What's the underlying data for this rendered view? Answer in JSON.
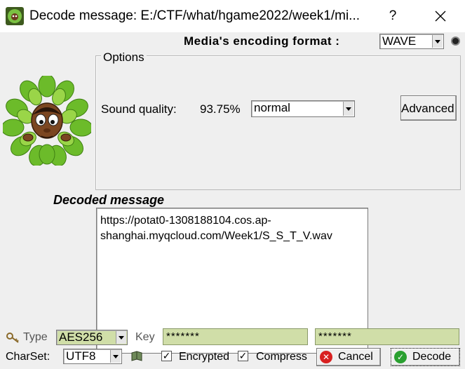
{
  "window": {
    "title": "Decode message: E:/CTF/what/hgame2022/week1/mi...",
    "help": "?"
  },
  "media": {
    "label": "Media's encoding format :",
    "format": "WAVE"
  },
  "options": {
    "legend": "Options",
    "sound_quality_label": "Sound quality:",
    "sound_quality_value": "93.75%",
    "quality_mode": "normal",
    "advanced_label": "Advanced"
  },
  "decoded": {
    "label": "Decoded message",
    "message": "https://potat0-1308188104.cos.ap-\nshanghai.myqcloud.com/Week1/S_S_T_V.wav"
  },
  "crypto": {
    "type_label": "Type",
    "type_value": "AES256",
    "key_label": "Key",
    "key1": "*******",
    "key2": "*******"
  },
  "bottom": {
    "charset_label": "CharSet:",
    "charset_value": "UTF8",
    "encrypted_label": "Encrypted",
    "compressed_label": "Compressed",
    "cancel_label": "Cancel",
    "decode_label": "Decode"
  },
  "colors": {
    "key_field_bg": "#d0dea8",
    "cancel_icon": "#d82020",
    "decode_icon": "#2aa030"
  },
  "icons": [
    "app-mascot-icon",
    "close-icon",
    "key-icon",
    "book-icon",
    "cancel-icon",
    "check-icon"
  ]
}
